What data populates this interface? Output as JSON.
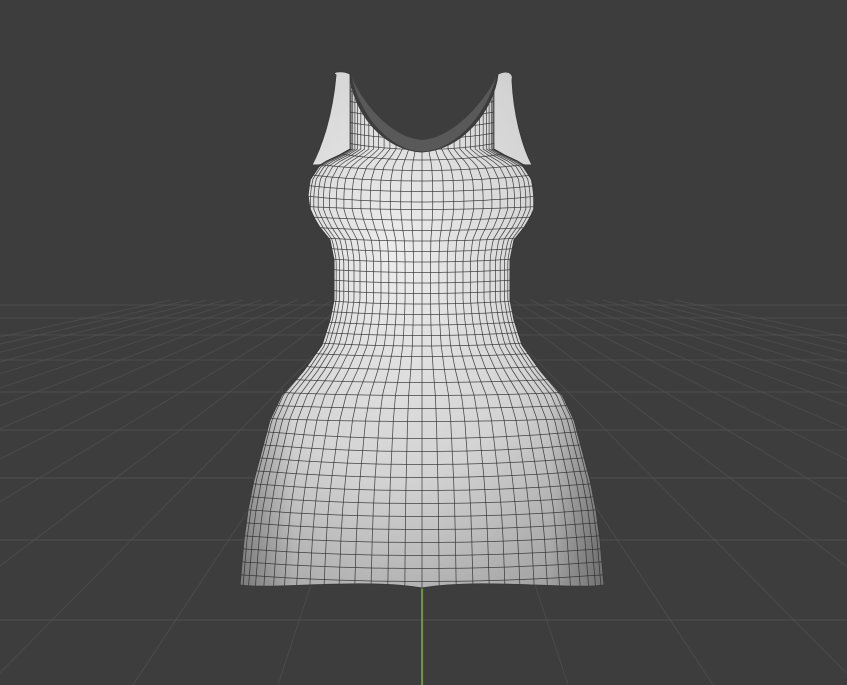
{
  "viewport": {
    "background_color": "#3d3d3d",
    "grid_color": "#555555",
    "y_axis_color": "#8cc63f"
  },
  "object": {
    "type": "mesh",
    "shape": "dress",
    "wireframe_overlay": true,
    "surface_color": "#d9d9d9",
    "wire_color": "#2b2b2b"
  }
}
